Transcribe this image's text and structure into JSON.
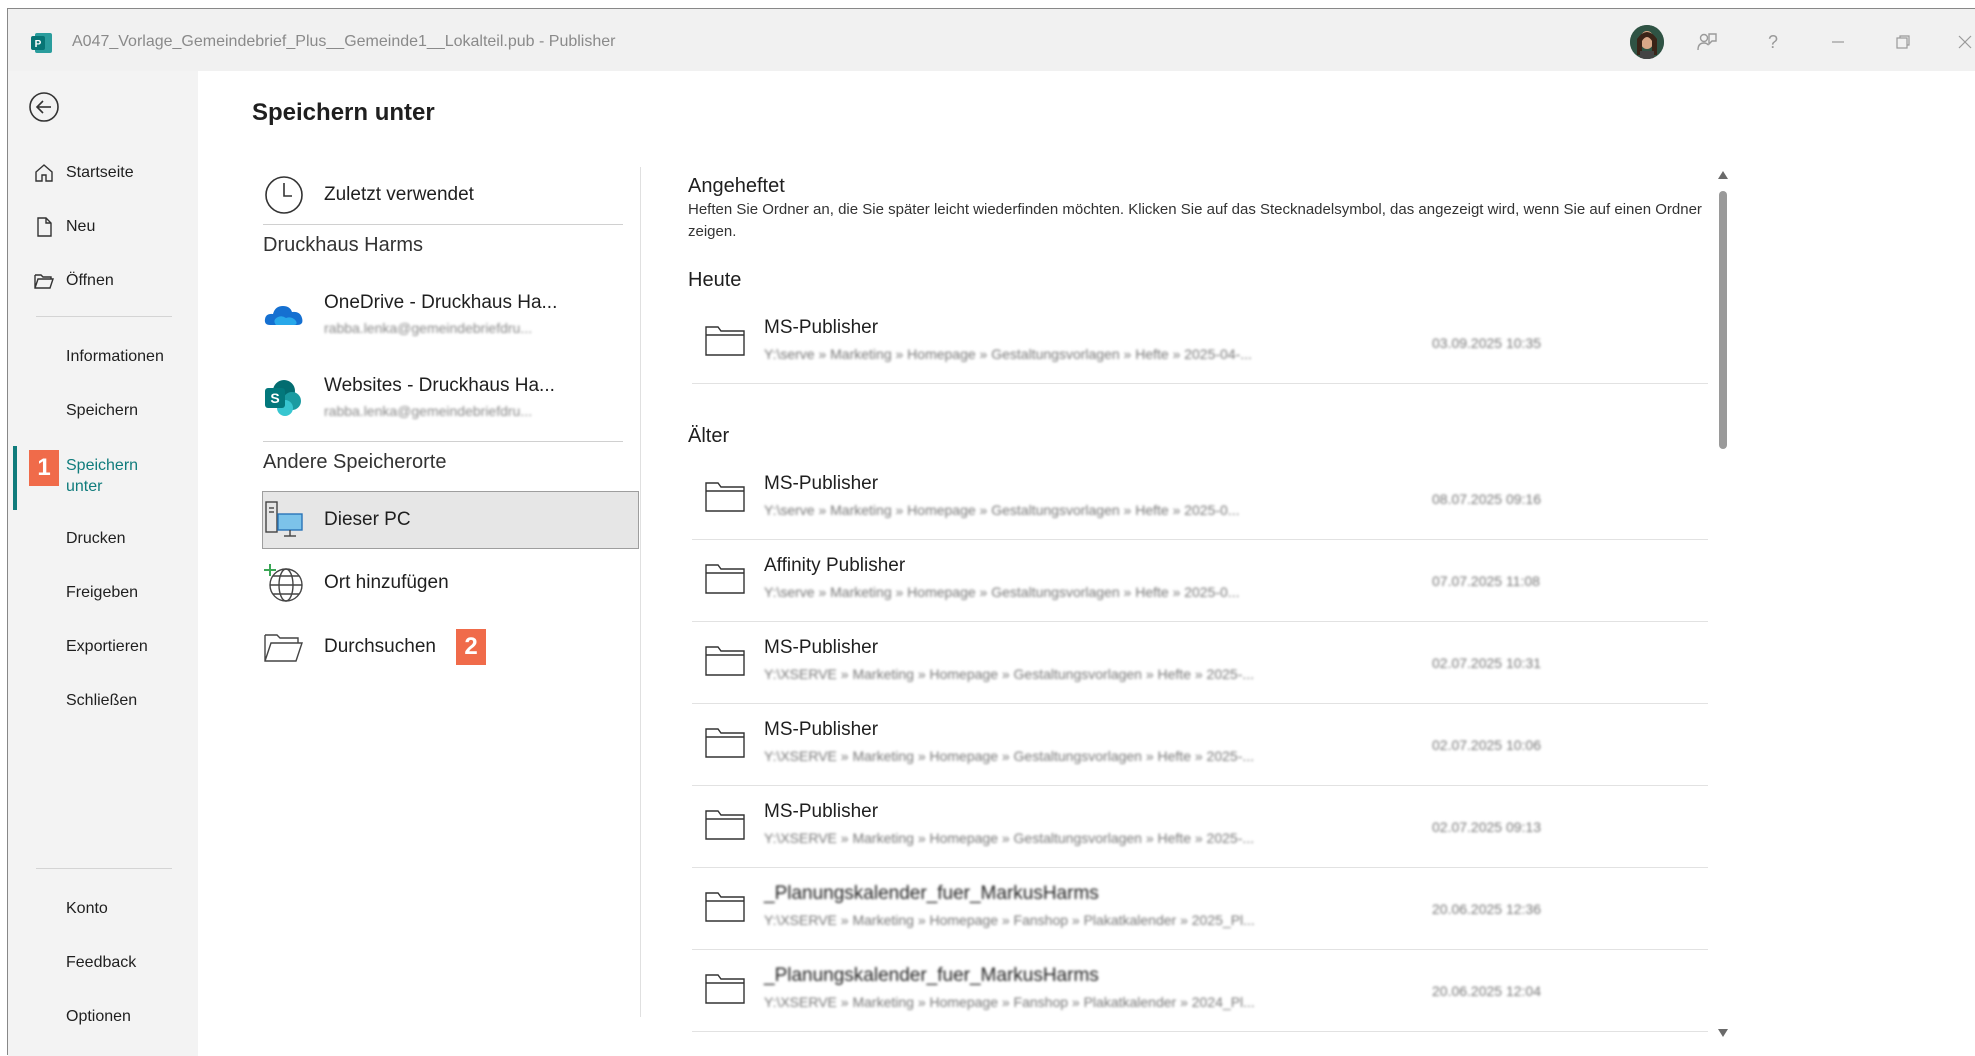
{
  "titlebar": {
    "title": "A047_Vorlage_Gemeindebrief_Plus__Gemeinde1__Lokalteil.pub  -  Publisher",
    "help_label": "?"
  },
  "nav": {
    "items": [
      {
        "label": "Startseite"
      },
      {
        "label": "Neu"
      },
      {
        "label": "Öffnen"
      },
      {
        "label": "Informationen"
      },
      {
        "label": "Speichern"
      },
      {
        "label": "Speichern unter"
      },
      {
        "label": "Drucken"
      },
      {
        "label": "Freigeben"
      },
      {
        "label": "Exportieren"
      },
      {
        "label": "Schließen"
      },
      {
        "label": "Konto"
      },
      {
        "label": "Feedback"
      },
      {
        "label": "Optionen"
      }
    ],
    "active_color": "#107c7c"
  },
  "badges": {
    "one": "1",
    "two": "2",
    "color": "#f06b4a"
  },
  "main": {
    "title": "Speichern unter",
    "recent": "Zuletzt verwendet",
    "group1": "Druckhaus Harms",
    "onedrive": {
      "label": "OneDrive - Druckhaus Ha...",
      "sub": "rabba.lenka@gemeindebriefdru..."
    },
    "websites": {
      "label": "Websites - Druckhaus Ha...",
      "sub": "rabba.lenka@gemeindebriefdru..."
    },
    "group2": "Andere Speicherorte",
    "this_pc": "Dieser PC",
    "add_place": "Ort hinzufügen",
    "browse": "Durchsuchen"
  },
  "right": {
    "pinned_head": "Angeheftet",
    "pinned_desc": "Heften Sie Ordner an, die Sie später leicht wiederfinden möchten. Klicken Sie auf das Stecknadelsymbol, das angezeigt wird, wenn Sie auf einen Ordner zeigen.",
    "today_head": "Heute",
    "older_head": "Älter",
    "today": [
      {
        "name": "MS-Publisher",
        "path": "Y:\\serve » Marketing » Homepage » Gestaltungsvorlagen » Hefte » 2025-04-...",
        "date": "03.09.2025 10:35"
      }
    ],
    "older": [
      {
        "name": "MS-Publisher",
        "path": "Y:\\serve » Marketing » Homepage » Gestaltungsvorlagen » Hefte » 2025-0...",
        "date": "08.07.2025 09:16"
      },
      {
        "name": "Affinity Publisher",
        "path": "Y:\\serve » Marketing » Homepage » Gestaltungsvorlagen » Hefte » 2025-0...",
        "date": "07.07.2025 11:08"
      },
      {
        "name": "MS-Publisher",
        "path": "Y:\\XSERVE » Marketing » Homepage » Gestaltungsvorlagen » Hefte » 2025-...",
        "date": "02.07.2025 10:31"
      },
      {
        "name": "MS-Publisher",
        "path": "Y:\\XSERVE » Marketing » Homepage » Gestaltungsvorlagen » Hefte » 2025-...",
        "date": "02.07.2025 10:06"
      },
      {
        "name": "MS-Publisher",
        "path": "Y:\\XSERVE » Marketing » Homepage » Gestaltungsvorlagen » Hefte » 2025-...",
        "date": "02.07.2025 09:13"
      },
      {
        "name": "_Planungskalender_fuer_MarkusHarms",
        "path": "Y:\\XSERVE » Marketing » Homepage » Fanshop » Plakatkalender » 2025_Pl...",
        "date": "20.06.2025 12:36"
      },
      {
        "name": "_Planungskalender_fuer_MarkusHarms",
        "path": "Y:\\XSERVE » Marketing » Homepage » Fanshop » Plakatkalender » 2024_Pl...",
        "date": "20.06.2025 12:04"
      }
    ]
  }
}
